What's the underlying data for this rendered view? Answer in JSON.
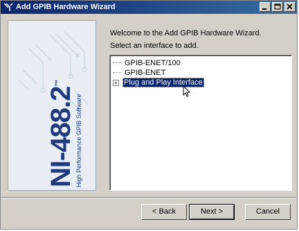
{
  "window": {
    "title": "Add GPIB Hardware Wizard",
    "buttons": {
      "minimize": "_",
      "maximize": "□",
      "close": "✕"
    }
  },
  "sidebar": {
    "logo_text": "NI-488.2",
    "trademark": "™",
    "subtitle": "High Performance GPIB Software"
  },
  "main": {
    "welcome_text": "Welcome to the Add GPIB Hardware Wizard.",
    "instruction_text": "Select an interface to add."
  },
  "tree": {
    "items": [
      {
        "label": "GPIB-ENET/100",
        "selected": false,
        "expandable": false
      },
      {
        "label": "GPIB-ENET",
        "selected": false,
        "expandable": false
      },
      {
        "label": "Plug and Play Interface",
        "selected": true,
        "expandable": true
      }
    ]
  },
  "footer": {
    "back_label": "< Back",
    "next_label": "Next >",
    "cancel_label": "Cancel"
  },
  "colors": {
    "titlebar_start": "#0a246a",
    "titlebar_end": "#3a6ea5",
    "face": "#d4d0c8",
    "selection": "#0a246a",
    "logo_blue": "#1e3a7a"
  }
}
